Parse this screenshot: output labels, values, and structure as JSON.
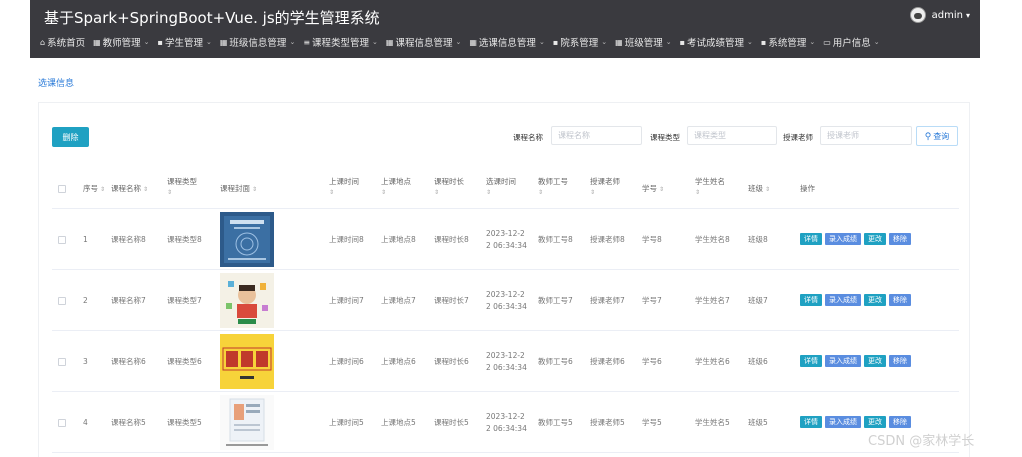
{
  "header": {
    "title": "基于Spark+SpringBoot+Vue. js的学生管理系统",
    "user": "admin",
    "nav": [
      {
        "icon": "⌂",
        "label": "系统首页",
        "dropdown": false
      },
      {
        "icon": "▦",
        "label": "教师管理",
        "dropdown": true
      },
      {
        "icon": "▪",
        "label": "学生管理",
        "dropdown": true
      },
      {
        "icon": "▦",
        "label": "班级信息管理",
        "dropdown": true
      },
      {
        "icon": "≡",
        "label": "课程类型管理",
        "dropdown": true
      },
      {
        "icon": "▦",
        "label": "课程信息管理",
        "dropdown": true
      },
      {
        "icon": "▦",
        "label": "选课信息管理",
        "dropdown": true
      },
      {
        "icon": "▪",
        "label": "院系管理",
        "dropdown": true
      },
      {
        "icon": "▦",
        "label": "班级管理",
        "dropdown": true
      },
      {
        "icon": "▪",
        "label": "考试成绩管理",
        "dropdown": true
      },
      {
        "icon": "▪",
        "label": "系统管理",
        "dropdown": true
      },
      {
        "icon": "▭",
        "label": "用户信息",
        "dropdown": true
      }
    ]
  },
  "breadcrumb": "选课信息",
  "toolbar": {
    "delete_label": "删除",
    "course_name_label": "课程名称",
    "course_name_placeholder": "课程名称",
    "course_type_label": "课程类型",
    "course_type_placeholder": "课程类型",
    "teacher_label": "授课老师",
    "teacher_placeholder": "授课老师",
    "search_label": "查询"
  },
  "table": {
    "headers": {
      "index": "序号",
      "course_name": "课程名称",
      "course_type": "课程类型",
      "cover": "课程封面",
      "class_time": "上课时间",
      "location": "上课地点",
      "duration": "课程时长",
      "select_time": "选课时间",
      "teacher_no": "教师工号",
      "teacher": "授课老师",
      "student_no": "学号",
      "student_name": "学生姓名",
      "class": "班级",
      "ops": "操作"
    },
    "rows": [
      {
        "index": "1",
        "course_name": "课程名称8",
        "course_type": "课程类型8",
        "class_time": "上课时间8",
        "location": "上课地点8",
        "duration": "课程时长8",
        "select_time": "2023-12-22 06:34:34",
        "teacher_no": "教师工号8",
        "teacher": "授课老师8",
        "student_no": "学号8",
        "student_name": "学生姓名8",
        "class": "班级8"
      },
      {
        "index": "2",
        "course_name": "课程名称7",
        "course_type": "课程类型7",
        "class_time": "上课时间7",
        "location": "上课地点7",
        "duration": "课程时长7",
        "select_time": "2023-12-22 06:34:34",
        "teacher_no": "教师工号7",
        "teacher": "授课老师7",
        "student_no": "学号7",
        "student_name": "学生姓名7",
        "class": "班级7"
      },
      {
        "index": "3",
        "course_name": "课程名称6",
        "course_type": "课程类型6",
        "class_time": "上课时间6",
        "location": "上课地点6",
        "duration": "课程时长6",
        "select_time": "2023-12-22 06:34:34",
        "teacher_no": "教师工号6",
        "teacher": "授课老师6",
        "student_no": "学号6",
        "student_name": "学生姓名6",
        "class": "班级6"
      },
      {
        "index": "4",
        "course_name": "课程名称5",
        "course_type": "课程类型5",
        "class_time": "上课时间5",
        "location": "上课地点5",
        "duration": "课程时长5",
        "select_time": "2023-12-22 06:34:34",
        "teacher_no": "教师工号5",
        "teacher": "授课老师5",
        "student_no": "学号5",
        "student_name": "学生姓名5",
        "class": "班级5"
      }
    ],
    "op_labels": {
      "detail": "详情",
      "score": "录入成绩",
      "edit": "更改",
      "remove": "移除"
    }
  },
  "watermark": "CSDN @家林学长"
}
